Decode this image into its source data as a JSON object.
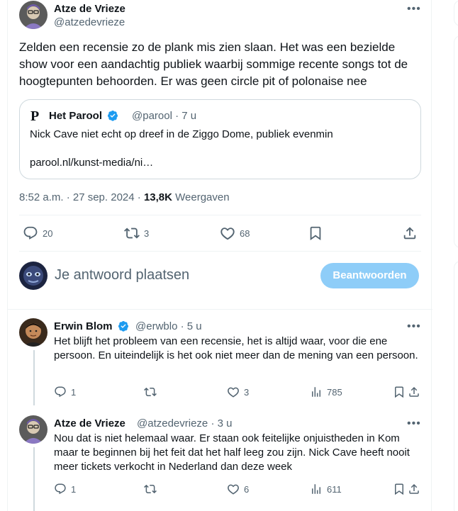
{
  "tweet": {
    "author_name": "Atze de Vrieze",
    "author_handle": "@atzedevrieze",
    "text": "Zelden een recensie zo de plank mis zien slaan. Het was een bezielde show voor een aandachtig publiek waarbij sommige recente songs tot de hoogtepunten behoorden. Er was geen circle pit of polonaise nee",
    "quote": {
      "logo": "P",
      "name": "Het Parool",
      "handle_time": "@parool · 7 u",
      "text": "Nick Cave niet echt op dreef in de Ziggo Dome, publiek evenmin",
      "link": "parool.nl/kunst-media/ni…"
    },
    "time": "8:52 a.m. · 27 sep. 2024 · ",
    "views_count": "13,8K",
    "views_label": " Weergaven",
    "actions": {
      "replies": "20",
      "reposts": "3",
      "likes": "68"
    }
  },
  "composer": {
    "prompt": "Je antwoord plaatsen",
    "button": "Beantwoorden"
  },
  "replies": [
    {
      "name": "Erwin Blom",
      "handle_time": "@erwblo · 5 u",
      "text": "Het blijft het probleem van een recensie, het is altijd waar, voor die ene persoon. En uiteindelijk is het ook niet meer dan de mening van een persoon.",
      "replies": "1",
      "reposts": "",
      "likes": "3",
      "views": "785"
    },
    {
      "name": "Atze de Vrieze",
      "handle_time": "@atzedevrieze · 3 u",
      "text": "Nou dat is niet helemaal waar. Er staan ook feitelijke onjuistheden in Kom maar te beginnen bij het feit dat het half leeg zou zijn. Nick Cave heeft nooit meer tickets verkocht in Nederland dan deze week",
      "replies": "1",
      "reposts": "",
      "likes": "6",
      "views": "611"
    }
  ],
  "colors": {
    "accent": "#1d9bf0",
    "button_disabled": "#8ecdf8",
    "secondary_text": "#536471",
    "border": "#eff3f4"
  },
  "icons": [
    "more-icon",
    "verified-icon",
    "reply-icon",
    "repost-icon",
    "like-icon",
    "bookmark-icon",
    "share-icon",
    "views-icon"
  ]
}
